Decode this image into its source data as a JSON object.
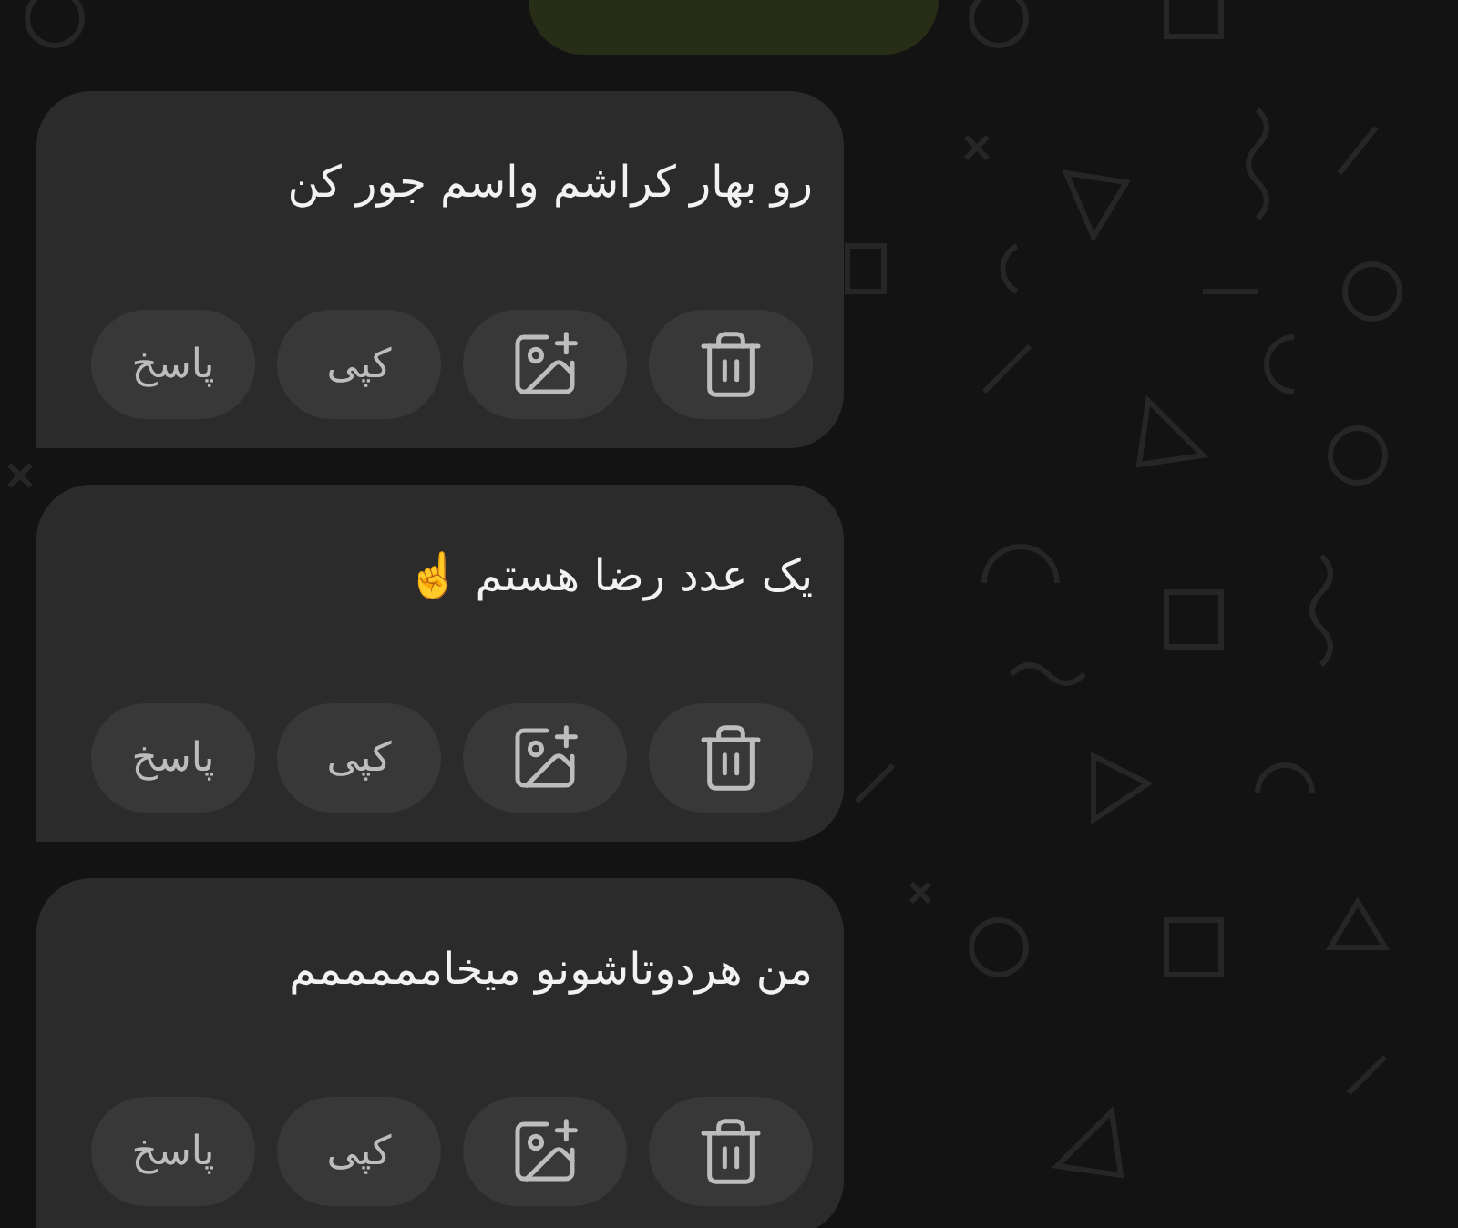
{
  "top_bubble": {
    "kind": "sent"
  },
  "messages": [
    {
      "text": "رو بهار کراشم واسم جور کن",
      "actions": [
        {
          "kind": "delete"
        },
        {
          "kind": "add-image"
        },
        {
          "kind": "text",
          "label": "کپی"
        },
        {
          "kind": "text",
          "label": "پاسخ"
        }
      ]
    },
    {
      "text": "یک عدد رضا هستم ☝️",
      "actions": [
        {
          "kind": "delete"
        },
        {
          "kind": "add-image"
        },
        {
          "kind": "text",
          "label": "کپی"
        },
        {
          "kind": "text",
          "label": "پاسخ"
        }
      ]
    },
    {
      "text": "من هردوتاشونو میخامممممم",
      "actions": [
        {
          "kind": "delete"
        },
        {
          "kind": "add-image"
        },
        {
          "kind": "text",
          "label": "کپی"
        },
        {
          "kind": "text",
          "label": "پاسخ"
        }
      ]
    }
  ]
}
